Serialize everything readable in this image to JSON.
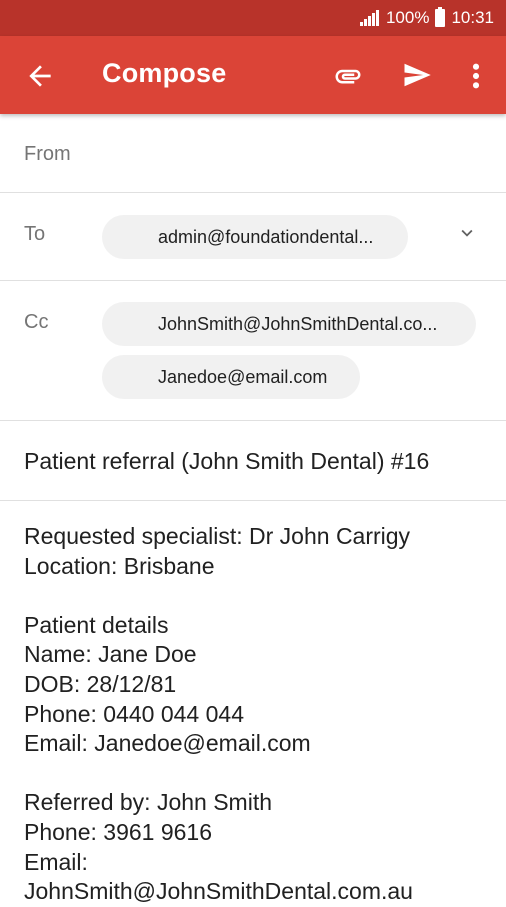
{
  "status_bar": {
    "battery_text": "100%",
    "time": "10:31"
  },
  "app_bar": {
    "title": "Compose"
  },
  "from": {
    "label": "From"
  },
  "to": {
    "label": "To",
    "chips": [
      "admin@foundationdental..."
    ]
  },
  "cc": {
    "label": "Cc",
    "chips": [
      "JohnSmith@JohnSmithDental.co...",
      "Janedoe@email.com"
    ]
  },
  "subject": "Patient referral (John Smith Dental) #16",
  "body": {
    "lines": [
      "Requested specialist: Dr John Carrigy",
      "Location: Brisbane",
      "",
      "Patient details",
      "Name: Jane  Doe",
      "DOB: 28/12/81",
      "Phone: 0440 044 044",
      "Email: Janedoe@email.com",
      "",
      "Referred by: John Smith",
      "Phone: 3961 9616",
      "Email:",
      "JohnSmith@JohnSmithDental.com.au"
    ]
  },
  "colors": {
    "app_bar": "#db4437",
    "status_bar": "#b8332a",
    "chip": "#f1f1f1"
  }
}
